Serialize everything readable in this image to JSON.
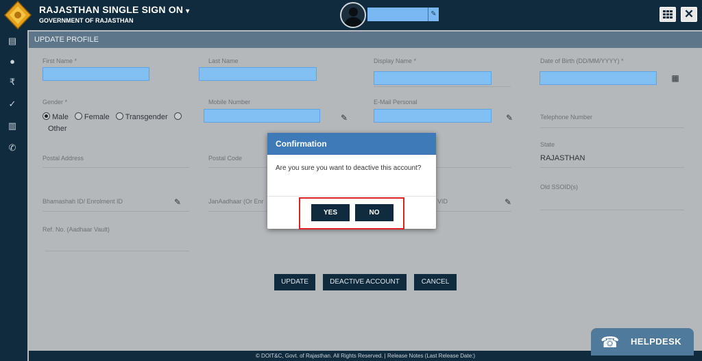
{
  "header": {
    "app_title": "RAJASTHAN SINGLE SIGN ON",
    "caret": "▾",
    "subtitle": "GOVERNMENT OF RAJASTHAN",
    "edit_icon": "✎",
    "close_label": "✕"
  },
  "sidebar": {
    "items": [
      {
        "icon": "id-card-icon",
        "glyph": "▤"
      },
      {
        "icon": "user-icon",
        "glyph": "●"
      },
      {
        "icon": "rupee-icon",
        "glyph": "₹"
      },
      {
        "icon": "check-circle-icon",
        "glyph": "✓"
      },
      {
        "icon": "bar-chart-icon",
        "glyph": "▥"
      },
      {
        "icon": "phone-icon",
        "glyph": "✆"
      }
    ]
  },
  "panel": {
    "title": "UPDATE PROFILE"
  },
  "form": {
    "first_name_label": "First Name *",
    "last_name_label": "Last Name",
    "display_name_label": "Display Name *",
    "dob_label": "Date of Birth (DD/MM/YYYY) *",
    "gender_label": "Gender *",
    "gender_options": [
      "Male",
      "Female",
      "Transgender",
      "Other"
    ],
    "gender_selected": "Male",
    "mobile_label": "Mobile Number",
    "email_label": "E-Mail Personal",
    "telephone_label": "Telephone Number",
    "postal_address_label": "Postal Address",
    "postal_code_label": "Postal Code",
    "state_label": "State",
    "state_value": "RAJASTHAN",
    "old_ssoid_label": "Old SSOID(s)",
    "bhamashah_label": "Bhamashah ID/ Enrolment ID",
    "janaadhaar_label": "JanAadhaar (Or Enr",
    "vid_label": "VID",
    "ref_no_label": "Ref. No. (Aadhaar Vault)",
    "calendar_icon": "▦"
  },
  "actions": {
    "update": "UPDATE",
    "deactive": "DEACTIVE ACCOUNT",
    "cancel": "CANCEL"
  },
  "modal": {
    "title": "Confirmation",
    "message": "Are you sure you want to deactive this account?",
    "yes": "YES",
    "no": "NO"
  },
  "footer": {
    "text": "© DOIT&C, Govt. of Rajasthan. All Rights Reserved.  |  Release Notes (Last Release Date:)"
  },
  "helpdesk": {
    "label": "HELPDESK",
    "icon": "☎"
  },
  "colors": {
    "navy": "#0f2b3d",
    "modal_header": "#3f7ab8",
    "input_blue": "#82bff2",
    "highlight_red": "#e0201f"
  }
}
